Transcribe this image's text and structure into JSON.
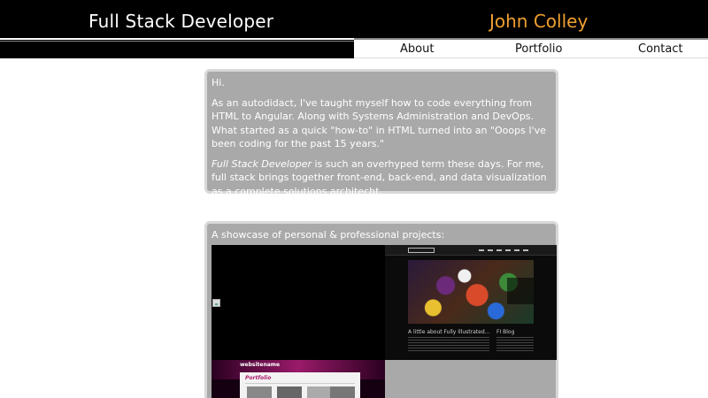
{
  "header": {
    "site_title": "Full Stack Developer",
    "owner_name": "John Colley",
    "owner_color": "#f0a030"
  },
  "nav": {
    "items": [
      {
        "label": "About"
      },
      {
        "label": "Portfolio"
      },
      {
        "label": "Contact"
      }
    ]
  },
  "about": {
    "greeting": "Hi.",
    "paragraph_1": "As an autodidact, I've taught myself how to code everything from HTML to Angular. Along with Systems Administration and DevOps. What started as a quick \"how-to\" in HTML turned into an \"Ooops I've been coding for the past 15 years.\"",
    "paragraph_2_emphasis": "Full Stack Developer",
    "paragraph_2_rest": " is such an overhyped term these days. For me, full stack brings together front-end, back-end, and data visualization as a complete solutions architecht."
  },
  "projects": {
    "title": "A showcase of personal & professional projects:",
    "thumbnails": [
      {
        "icon": "broken-image-icon"
      },
      {
        "heading_left": "A little about Fully Illustrated...",
        "heading_right": "FI Blog"
      },
      {
        "site_name": "websitename",
        "section": "Portfolio"
      }
    ]
  }
}
